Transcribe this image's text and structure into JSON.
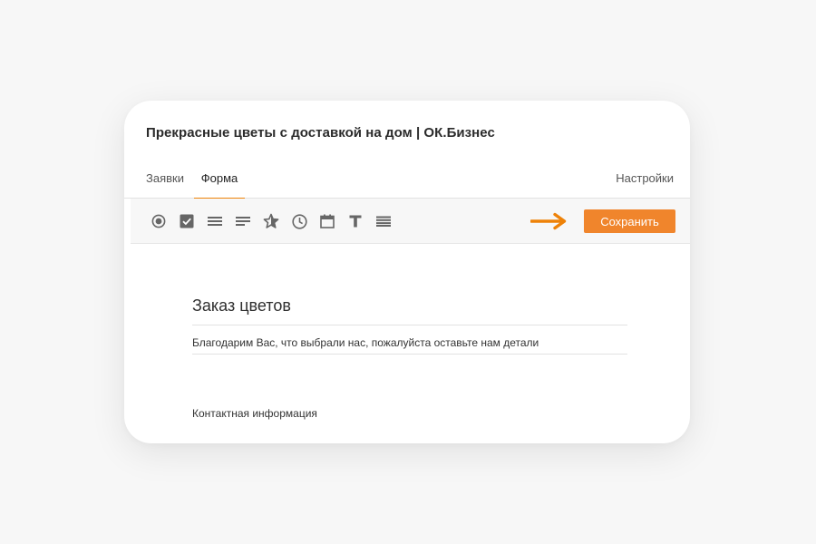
{
  "page": {
    "title": "Прекрасные цветы с доставкой на дом | ОК.Бизнес"
  },
  "tabs": [
    {
      "label": "Заявки",
      "active": false
    },
    {
      "label": "Форма",
      "active": true
    },
    {
      "label": "Настройки",
      "active": false
    }
  ],
  "toolbar": {
    "tools": [
      {
        "icon": "radio-button-icon"
      },
      {
        "icon": "checkbox-icon"
      },
      {
        "icon": "dropdown-list-icon"
      },
      {
        "icon": "paragraph-text-icon"
      },
      {
        "icon": "rating-star-icon"
      },
      {
        "icon": "time-clock-icon"
      },
      {
        "icon": "calendar-date-icon"
      },
      {
        "icon": "text-title-icon"
      },
      {
        "icon": "section-divider-icon"
      }
    ],
    "save_label": "Сохранить"
  },
  "form": {
    "heading": "Заказ цветов",
    "description": "Благодарим Вас, что выбрали нас, пожалуйста оставьте нам детали",
    "section_label": "Контактная информация"
  },
  "colors": {
    "accent": "#f0852c",
    "tab_underline": "#ee8208",
    "icon": "#666666",
    "page_background": "#f7f7f7"
  }
}
